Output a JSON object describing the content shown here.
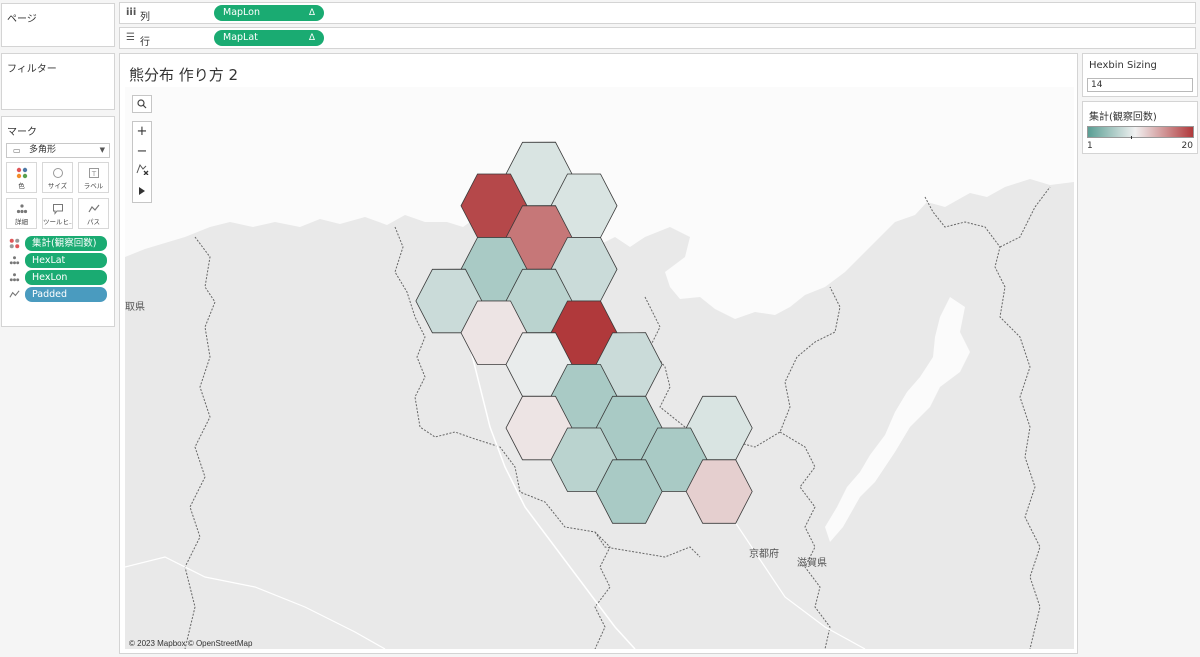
{
  "pages_panel": {
    "title": "ページ"
  },
  "filters_panel": {
    "title": "フィルター"
  },
  "marks_panel": {
    "title": "マーク",
    "mark_type": "多角形",
    "buttons": [
      {
        "icon": "color-icon",
        "label": "色"
      },
      {
        "icon": "size-icon",
        "label": "サイズ"
      },
      {
        "icon": "label-icon",
        "label": "ラベル"
      },
      {
        "icon": "detail-icon",
        "label": "詳細"
      },
      {
        "icon": "tooltip-icon",
        "label": "ツールヒ..."
      },
      {
        "icon": "path-icon",
        "label": "パス"
      }
    ],
    "fields": [
      {
        "icon": "color-icon",
        "label": "集計(観察回数)",
        "color": "#1aab72"
      },
      {
        "icon": "detail-icon",
        "label": "HexLat",
        "color": "#1aab72"
      },
      {
        "icon": "detail-icon",
        "label": "HexLon",
        "color": "#1aab72"
      },
      {
        "icon": "path-icon",
        "label": "Padded",
        "color": "#4a9bbf"
      }
    ]
  },
  "shelves": {
    "columns": {
      "label": "列",
      "pill": "MapLon",
      "delta": "Δ"
    },
    "rows": {
      "label": "行",
      "pill": "MapLat",
      "delta": "Δ"
    }
  },
  "sheet": {
    "title": "熊分布 作り方 2",
    "attribution": "© 2023 Mapbox © OpenStreetMap",
    "map_labels": [
      {
        "id": "tottori",
        "text": "取県"
      },
      {
        "id": "kyoto",
        "text": "京都府"
      },
      {
        "id": "shiga",
        "text": "滋賀県"
      }
    ]
  },
  "parameter": {
    "title": "Hexbin Sizing",
    "value": "14"
  },
  "legend": {
    "title": "集計(観察回数)",
    "min_label": "1",
    "max_label": "20",
    "min_color": "#5a9e94",
    "mid_color": "#f1f1f1",
    "max_color": "#b0393b"
  },
  "hexbins": [
    {
      "col": 0,
      "row": 0,
      "value": 8
    },
    {
      "col": -1,
      "row": 0.5,
      "value": 19
    },
    {
      "col": 1,
      "row": 0.5,
      "value": 8
    },
    {
      "col": 0,
      "row": 1,
      "value": 16
    },
    {
      "col": -1,
      "row": 1.5,
      "value": 5
    },
    {
      "col": 1,
      "row": 1.5,
      "value": 7
    },
    {
      "col": -2,
      "row": 2,
      "value": 7
    },
    {
      "col": 0,
      "row": 2,
      "value": 6
    },
    {
      "col": -1,
      "row": 2.5,
      "value": 10
    },
    {
      "col": 1,
      "row": 2.5,
      "value": 20
    },
    {
      "col": 0,
      "row": 3,
      "value": 9
    },
    {
      "col": 2,
      "row": 3,
      "value": 7
    },
    {
      "col": 1,
      "row": 3.5,
      "value": 5
    },
    {
      "col": 0,
      "row": 4,
      "value": 10
    },
    {
      "col": 2,
      "row": 4,
      "value": 5
    },
    {
      "col": 4,
      "row": 4,
      "value": 8
    },
    {
      "col": 1,
      "row": 4.5,
      "value": 6
    },
    {
      "col": 3,
      "row": 4.5,
      "value": 5
    },
    {
      "col": 2,
      "row": 5,
      "value": 5
    },
    {
      "col": 4,
      "row": 5,
      "value": 11
    }
  ]
}
